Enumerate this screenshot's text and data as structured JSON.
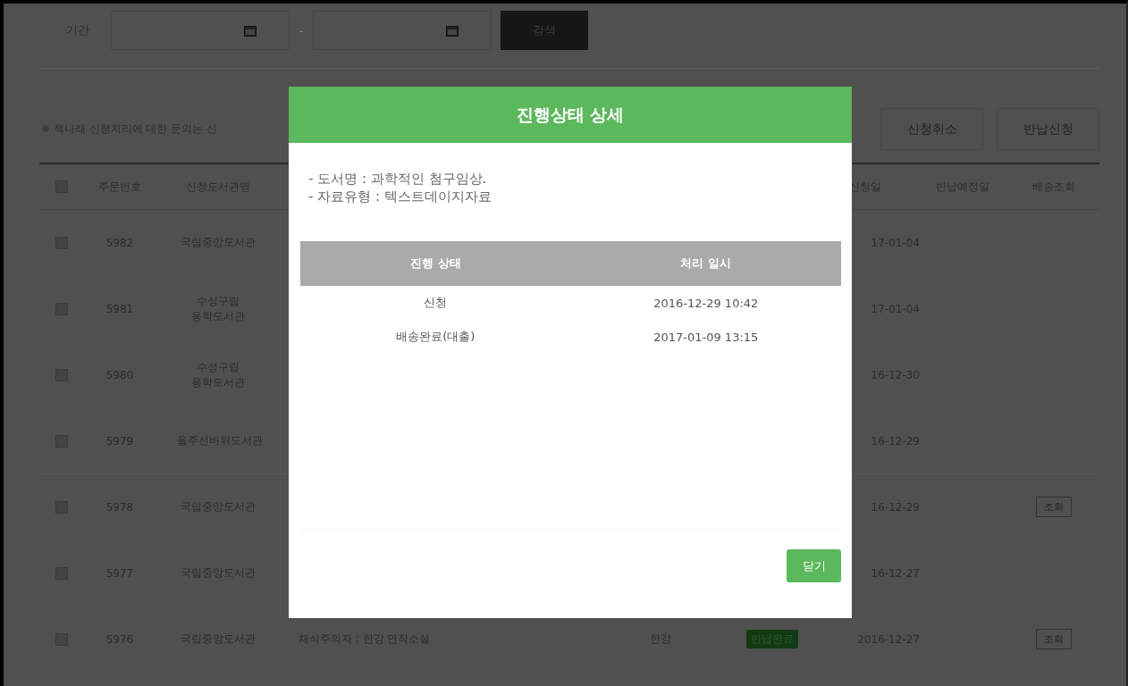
{
  "search": {
    "label": "기간",
    "separator": "-",
    "button": "검색"
  },
  "notice": "※ 책나래 신청처리에 대한 문의는 신",
  "actions": [
    "신청취소",
    "반납신청"
  ],
  "table": {
    "header_checked": false,
    "columns": [
      "주문번호",
      "신청도서관명",
      "신청일",
      "반납예정일",
      "배송조회"
    ],
    "rows": [
      {
        "checked": false,
        "no": "5982",
        "library": "국립중앙도서관",
        "date": "17-01-04"
      },
      {
        "checked": false,
        "no": "5981",
        "library": "수성구립 용학도서관",
        "date": "17-01-04"
      },
      {
        "checked": false,
        "no": "5980",
        "library": "수성구립 용학도서관",
        "date": "16-12-30"
      },
      {
        "checked": false,
        "no": "5979",
        "library": "울주선바위도서관",
        "date": "16-12-29"
      },
      {
        "checked": false,
        "no": "5978",
        "library": "국립중앙도서관",
        "date": "16-12-29",
        "delivery": "조회"
      },
      {
        "checked": false,
        "no": "5977",
        "library": "국립중앙도서관",
        "date": "16-12-27"
      },
      {
        "checked": false,
        "no": "5976",
        "library": "국립중앙도서관",
        "title": "채식주의자 : 한강 연작소설",
        "author": "한강",
        "status": "반납완료",
        "date": "2016-12-27",
        "delivery": "조회"
      }
    ]
  },
  "modal": {
    "title": "진행상태 상세",
    "info": [
      "- 도서명 : 과학적인 첨구임상.",
      "- 자료유형 : 텍스트데이지자료"
    ],
    "columns": [
      "진행 상태",
      "처리 일시"
    ],
    "rows": [
      {
        "status": "신청",
        "time": "2016-12-29 10:42"
      },
      {
        "status": "배송완료(대출)",
        "time": "2017-01-09 13:15"
      }
    ],
    "close": "닫기"
  }
}
